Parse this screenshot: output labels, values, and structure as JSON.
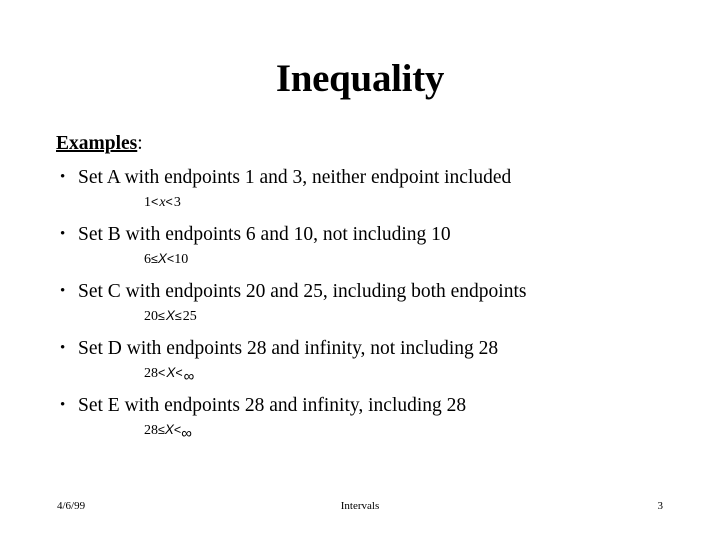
{
  "slide": {
    "title": "Inequality",
    "heading": {
      "underlined_text": "Examples",
      "trailing": ":"
    },
    "bullet_marker": "•",
    "items": [
      {
        "text": "Set A with endpoints 1 and 3, neither endpoint included",
        "equation": {
          "left": "1",
          "rel1": "<",
          "var": "x",
          "rel2": "<",
          "right": "3",
          "plain": "1 < x < 3"
        }
      },
      {
        "text": "Set B with endpoints 6 and 10, not including 10",
        "equation": {
          "left": "6",
          "rel1": "≤",
          "var": "X",
          "rel2": "<",
          "right": "10",
          "plain": "6 ≤ X < 10"
        }
      },
      {
        "text": "Set C with endpoints 20 and 25, including both endpoints",
        "equation": {
          "left": "20",
          "rel1": "≤",
          "var": "X",
          "rel2": "≤",
          "right": "25",
          "plain": "20 ≤ X ≤ 25"
        }
      },
      {
        "text": "Set D with endpoints 28 and infinity, not including 28",
        "equation": {
          "left": "28",
          "rel1": "<",
          "var": "X",
          "rel2": "<",
          "right": "∞",
          "plain": "28 < X < ∞"
        }
      },
      {
        "text": "Set E with endpoints 28 and infinity, including 28",
        "equation": {
          "left": "28",
          "rel1": "≤",
          "var": "X",
          "rel2": "<",
          "right": "∞",
          "plain": "28 ≤ X < ∞"
        }
      }
    ],
    "footer": {
      "date": "4/6/99",
      "center": "Intervals",
      "page": "3"
    }
  }
}
